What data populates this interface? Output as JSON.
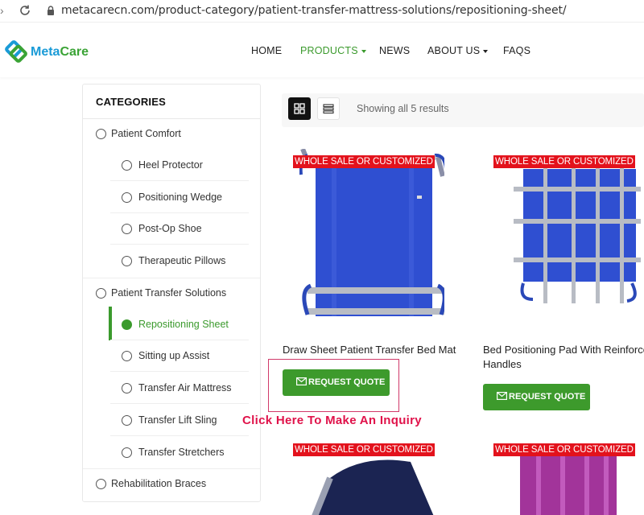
{
  "browser": {
    "url": "metacarecn.com/product-category/patient-transfer-mattress-solutions/repositioning-sheet/"
  },
  "header": {
    "logo": {
      "brand_part1": "Meta",
      "brand_part2": "Care",
      "colors": {
        "blue": "#1a9bd7",
        "green": "#3aa335"
      }
    },
    "menu": [
      {
        "label": "HOME",
        "active": false,
        "dropdown": false
      },
      {
        "label": "PRODUCTS",
        "active": true,
        "dropdown": true
      },
      {
        "label": "NEWS",
        "active": false,
        "dropdown": false
      },
      {
        "label": "ABOUT US",
        "active": false,
        "dropdown": true
      },
      {
        "label": "FAQS",
        "active": false,
        "dropdown": false
      }
    ]
  },
  "sidebar": {
    "title": "CATEGORIES",
    "groups": [
      {
        "label": "Patient Comfort",
        "children": [
          "Heel Protector",
          "Positioning Wedge",
          "Post-Op Shoe",
          "Therapeutic Pillows"
        ]
      },
      {
        "label": "Patient Transfer Solutions",
        "children": [
          "Repositioning Sheet",
          "Sitting up Assist",
          "Transfer Air Mattress",
          "Transfer Lift Sling",
          "Transfer Stretchers"
        ]
      },
      {
        "label": "Rehabilitation Braces",
        "children": []
      }
    ],
    "selected": "Repositioning Sheet"
  },
  "toolbar": {
    "grid_icon": "grid-icon",
    "list_icon": "list-icon",
    "results_text": "Showing all 5 results"
  },
  "products": [
    {
      "badge": "WHOLE SALE OR CUSTOMIZED",
      "name": "Draw Sheet Patient Transfer Bed Mat",
      "name_line2": "",
      "button": "REQUEST QUOTE",
      "image": "blue-draw-sheet"
    },
    {
      "badge": "WHOLE SALE OR CUSTOMIZED",
      "name": "Bed Positioning Pad With Reinforced",
      "name_line2": "Handles",
      "button": "REQUEST QUOTE",
      "image": "blue-positioning-pad"
    },
    {
      "badge": "WHOLE SALE OR CUSTOMIZED",
      "image": "navy-sheet-partial"
    },
    {
      "badge": "WHOLE SALE OR CUSTOMIZED",
      "image": "purple-sheet-partial"
    }
  ],
  "annotation": {
    "text": "Click Here To Make An Inquiry",
    "color": "#e0124a"
  },
  "colors": {
    "accent_green": "#3b9a2d",
    "badge_red": "#e3121c"
  }
}
